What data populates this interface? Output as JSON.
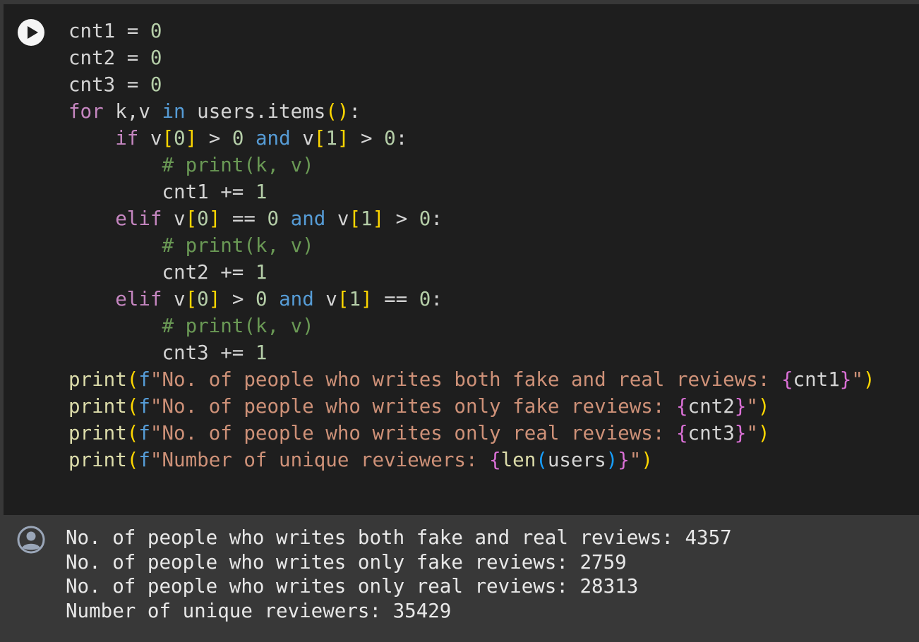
{
  "cell": {
    "run_button_icon": "play-icon",
    "output_icon": "user-icon"
  },
  "code": {
    "line1": {
      "var": "cnt1",
      "op": " = ",
      "val": "0"
    },
    "line2": {
      "var": "cnt2",
      "op": " = ",
      "val": "0"
    },
    "line3": {
      "var": "cnt3",
      "op": " = ",
      "val": "0"
    },
    "line4": {
      "kw_for": "for",
      "t1": " k,v ",
      "kw_in": "in",
      "t2": " users.items",
      "p_open": "(",
      "p_close": ")",
      "t3": ":"
    },
    "line5": {
      "indent": "    ",
      "kw_if": "if",
      "t1": " v",
      "b1": "[",
      "n1": "0",
      "b2": "]",
      "t2": " > ",
      "n2": "0",
      "t3": " ",
      "kw_and": "and",
      "t4": " v",
      "b3": "[",
      "n3": "1",
      "b4": "]",
      "t5": " > ",
      "n4": "0",
      "t6": ":"
    },
    "line6": {
      "indent": "        ",
      "comment": "# print(k, v)"
    },
    "line7": {
      "indent": "        ",
      "var": "cnt1",
      "op": " += ",
      "val": "1"
    },
    "line8": {
      "indent": "    ",
      "kw_elif": "elif",
      "t1": " v",
      "b1": "[",
      "n1": "0",
      "b2": "]",
      "t2": " == ",
      "n2": "0",
      "t3": " ",
      "kw_and": "and",
      "t4": " v",
      "b3": "[",
      "n3": "1",
      "b4": "]",
      "t5": " > ",
      "n4": "0",
      "t6": ":"
    },
    "line9": {
      "indent": "        ",
      "comment": "# print(k, v)"
    },
    "line10": {
      "indent": "        ",
      "var": "cnt2",
      "op": " += ",
      "val": "1"
    },
    "line11": {
      "indent": "    ",
      "kw_elif": "elif",
      "t1": " v",
      "b1": "[",
      "n1": "0",
      "b2": "]",
      "t2": " > ",
      "n2": "0",
      "t3": " ",
      "kw_and": "and",
      "t4": " v",
      "b3": "[",
      "n3": "1",
      "b4": "]",
      "t5": " == ",
      "n4": "0",
      "t6": ":"
    },
    "line12": {
      "indent": "        ",
      "comment": "# print(k, v)"
    },
    "line13": {
      "indent": "        ",
      "var": "cnt3",
      "op": " += ",
      "val": "1"
    },
    "line14": {
      "fn": "print",
      "p_open": "(",
      "f": "f",
      "s1": "\"No. of people who writes both fake and real reviews: ",
      "c_open": "{",
      "expr": "cnt1",
      "c_close": "}",
      "s2": "\"",
      "p_close": ")"
    },
    "line15": {
      "fn": "print",
      "p_open": "(",
      "f": "f",
      "s1": "\"No. of people who writes only fake reviews: ",
      "c_open": "{",
      "expr": "cnt2",
      "c_close": "}",
      "s2": "\"",
      "p_close": ")"
    },
    "line16": {
      "fn": "print",
      "p_open": "(",
      "f": "f",
      "s1": "\"No. of people who writes only real reviews: ",
      "c_open": "{",
      "expr": "cnt3",
      "c_close": "}",
      "s2": "\"",
      "p_close": ")"
    },
    "line17": {
      "fn": "print",
      "p_open": "(",
      "f": "f",
      "s1": "\"Number of unique reviewers: ",
      "c_open": "{",
      "fn2": "len",
      "p2_open": "(",
      "arg": "users",
      "p2_close": ")",
      "c_close": "}",
      "s2": "\"",
      "p_close": ")"
    }
  },
  "output": {
    "lines": [
      "No. of people who writes both fake and real reviews: 4357",
      "No. of people who writes only fake reviews: 2759",
      "No. of people who writes only real reviews: 28313",
      "Number of unique reviewers: 35429"
    ]
  }
}
